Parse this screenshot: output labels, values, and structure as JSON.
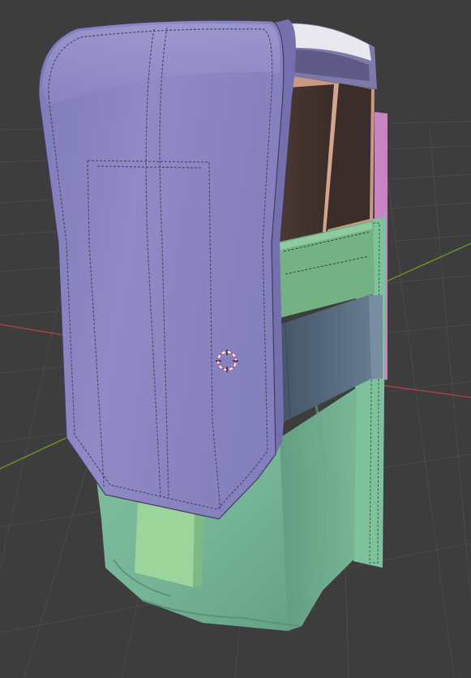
{
  "app": {
    "name": "3D Viewport",
    "view_mode": "solid",
    "object_shading": "random-color"
  },
  "scene": {
    "show_floor_grid": true,
    "show_axes": true,
    "has_3d_cursor": true,
    "colors": {
      "background": "#3d3d3d",
      "grid_line": "#4a4a4a",
      "x_axis": "#b8404c",
      "y_axis": "#6c9a26",
      "flap": "#8c87c4",
      "flap_stitch": "#4b4a63",
      "pouch_body": "#7fbf9c",
      "pouch_band": "#52677a",
      "pouch_rim": "#74b184",
      "magazine_face": "#3e2f2b",
      "magazine_top": "#c99783",
      "back_strap": "#c983c2",
      "cursor_red": "#e04a4a"
    }
  },
  "objects": [
    {
      "name": "flap",
      "icon": "mesh-icon"
    },
    {
      "name": "pouch-body",
      "icon": "mesh-icon"
    },
    {
      "name": "elastic-band",
      "icon": "mesh-icon"
    },
    {
      "name": "top-rim",
      "icon": "mesh-icon"
    },
    {
      "name": "magazine-insert",
      "icon": "mesh-icon"
    },
    {
      "name": "back-strap",
      "icon": "mesh-icon"
    },
    {
      "name": "pull-tab",
      "icon": "mesh-icon"
    }
  ]
}
